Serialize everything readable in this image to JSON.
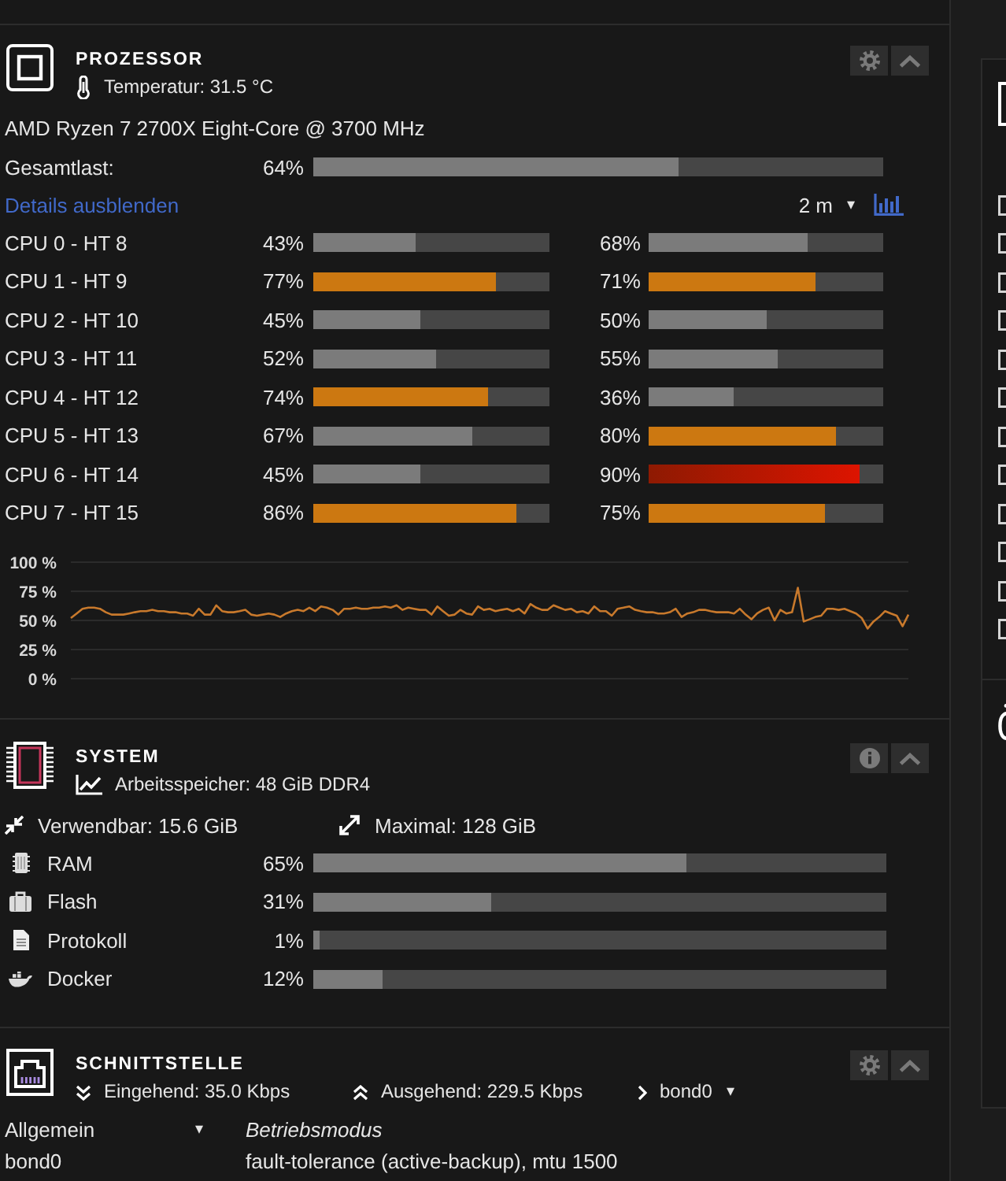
{
  "processor": {
    "title": "PROZESSOR",
    "temperature": "Temperatur: 31.5 °C",
    "model": "AMD Ryzen 7 2700X Eight-Core @ 3700 MHz",
    "total": {
      "label": "Gesamtlast:",
      "reading": "64%",
      "level": 0.64
    },
    "details_link": "Details ausblenden",
    "range": {
      "value": "2 m",
      "caret": "▾"
    },
    "cores": [
      {
        "label": "CPU 0 - HT 8",
        "threads": [
          {
            "reading": "43%",
            "level": 0.43
          },
          {
            "reading": "68%",
            "level": 0.68
          }
        ]
      },
      {
        "label": "CPU 1 - HT 9",
        "threads": [
          {
            "reading": "77%",
            "level": 0.77
          },
          {
            "reading": "71%",
            "level": 0.71
          }
        ]
      },
      {
        "label": "CPU 2 - HT 10",
        "threads": [
          {
            "reading": "45%",
            "level": 0.45
          },
          {
            "reading": "50%",
            "level": 0.5
          }
        ]
      },
      {
        "label": "CPU 3 - HT 11",
        "threads": [
          {
            "reading": "52%",
            "level": 0.52
          },
          {
            "reading": "55%",
            "level": 0.55
          }
        ]
      },
      {
        "label": "CPU 4 - HT 12",
        "threads": [
          {
            "reading": "74%",
            "level": 0.74
          },
          {
            "reading": "36%",
            "level": 0.36
          }
        ]
      },
      {
        "label": "CPU 5 - HT 13",
        "threads": [
          {
            "reading": "67%",
            "level": 0.67
          },
          {
            "reading": "80%",
            "level": 0.8
          }
        ]
      },
      {
        "label": "CPU 6 - HT 14",
        "threads": [
          {
            "reading": "45%",
            "level": 0.45
          },
          {
            "reading": "90%",
            "level": 0.9
          }
        ]
      },
      {
        "label": "CPU 7 - HT 15",
        "threads": [
          {
            "reading": "86%",
            "level": 0.86
          },
          {
            "reading": "75%",
            "level": 0.75
          }
        ]
      }
    ],
    "chart_data": {
      "type": "line",
      "grid": true,
      "ylim": [
        0,
        100
      ],
      "yticks": [
        {
          "value": 100,
          "label": "100 %"
        },
        {
          "value": 75,
          "label": "75 %"
        },
        {
          "value": 50,
          "label": "50 %"
        },
        {
          "value": 25,
          "label": "25 %"
        },
        {
          "value": 0,
          "label": "0 %"
        }
      ],
      "series": [
        {
          "color": "#c8792c",
          "values": [
            52,
            56,
            60,
            61,
            61,
            60,
            57,
            55,
            55,
            55,
            56,
            57,
            58,
            58,
            59,
            58,
            58,
            57,
            57,
            56,
            56,
            54,
            60,
            55,
            55,
            63,
            58,
            57,
            57,
            58,
            59,
            55,
            54,
            55,
            56,
            55,
            53,
            56,
            58,
            59,
            58,
            61,
            58,
            62,
            61,
            59,
            55,
            60,
            60,
            61,
            60,
            60,
            61,
            61,
            62,
            61,
            63,
            59,
            61,
            60,
            59,
            59,
            55,
            62,
            58,
            54,
            55,
            59,
            56,
            55,
            62,
            59,
            60,
            58,
            59,
            60,
            58,
            60,
            56,
            64,
            61,
            59,
            59,
            63,
            61,
            59,
            60,
            57,
            58,
            56,
            62,
            58,
            58,
            54,
            60,
            61,
            62,
            59,
            58,
            57,
            57,
            56,
            56,
            57,
            60,
            53,
            56,
            57,
            59,
            59,
            58,
            57,
            57,
            57,
            56,
            60,
            55,
            51,
            56,
            59,
            61,
            50,
            59,
            56,
            57,
            78,
            49,
            51,
            53,
            54,
            60,
            60,
            59,
            60,
            58,
            56,
            52,
            43,
            49,
            53,
            58,
            56,
            54,
            45,
            55
          ]
        }
      ]
    }
  },
  "system": {
    "title": "SYSTEM",
    "memory": "Arbeitsspeicher: 48 GiB DDR4",
    "usable": "Verwendbar: 15.6 GiB",
    "maximum": "Maximal: 128 GiB",
    "usage": [
      {
        "kind": "ram",
        "label": "RAM",
        "reading": "65%",
        "level": 0.65
      },
      {
        "kind": "flash",
        "label": "Flash",
        "reading": "31%",
        "level": 0.31
      },
      {
        "kind": "log",
        "label": "Protokoll",
        "reading": "1%",
        "level": 0.01
      },
      {
        "kind": "docker",
        "label": "Docker",
        "reading": "12%",
        "level": 0.12
      }
    ]
  },
  "interface": {
    "title": "SCHNITTSTELLE",
    "inbound": "Eingehend: 35.0 Kbps",
    "outbound": "Ausgehend: 229.5 Kbps",
    "port": {
      "value": "bond0",
      "caret": "▾"
    },
    "table": {
      "section": {
        "value": "Allgemein",
        "caret": "▾"
      },
      "column": "Betriebsmodus",
      "rows": [
        {
          "name": "bond0",
          "mode": "fault-tolerance (active-backup), mtu 1500"
        }
      ]
    }
  },
  "sidebar": {
    "checkboxes": [
      {
        "checked": false
      },
      {
        "checked": false
      },
      {
        "checked": false
      },
      {
        "checked": false
      },
      {
        "checked": false
      },
      {
        "checked": false
      },
      {
        "checked": false
      },
      {
        "checked": false
      },
      {
        "checked": false
      },
      {
        "checked": false
      },
      {
        "checked": false
      },
      {
        "checked": false
      }
    ]
  }
}
